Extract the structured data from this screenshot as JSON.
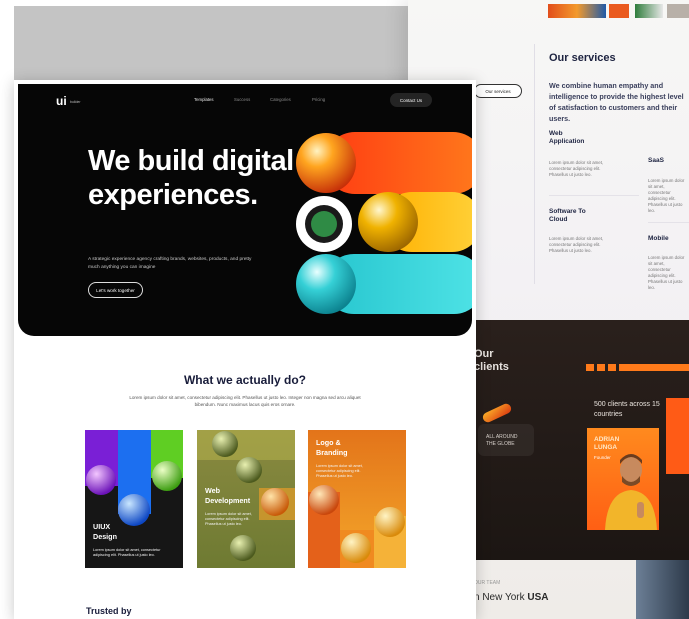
{
  "services": {
    "title": "Our services",
    "description": "We combine human empathy and intelligence to provide the highest level of satisfaction to customers and their users.",
    "pill": "Our services",
    "items": [
      {
        "title": "Web\nApplication",
        "text": "Lorem ipsum dolor sit amet, consectetur adipiscing elit. Phasellus ut justo leo."
      },
      {
        "title": "SaaS",
        "text": "Lorem ipsum dolor sit amet, consectetur adipiscing elit. Phasellus ut justo leo."
      },
      {
        "title": "Software To\nCloud",
        "text": "Lorem ipsum dolor sit amet, consectetur adipiscing elit. Phasellus ut justo leo."
      },
      {
        "title": "Mobile",
        "text": "Lorem ipsum dolor sit amet, consectetur adipiscing elit. Phasellus ut justo leo."
      }
    ]
  },
  "clients": {
    "title": "Our\nclients",
    "globe": "ALL AROUND\nTHE GLOBE",
    "count": "500 clients across 15 countries",
    "person_name": "ADRIAN\nLUNGA",
    "person_role": "Founder"
  },
  "team": {
    "label": "OUR TEAM",
    "title_prefix": "n New York ",
    "title_bold": "USA"
  },
  "header": {
    "logo": "ui",
    "logo_sub": "builder",
    "nav": [
      "Templates",
      "Success",
      "Categories",
      "Pricing"
    ],
    "contact": "Contact Us"
  },
  "hero": {
    "headline": "We build digital experiences.",
    "subtext": "A strategic experience agency crafting brands, websites, products, and pretty much anything you can imagine",
    "cta": "Let's work together"
  },
  "what": {
    "title": "What we actually do?",
    "description": "Lorem ipsum dolor sit amet, consectetur adipiscing elit. Phasellus ut justo leo. Integer non magna sed arcu aliquet bibendum. Nunc maximus lacus quis eros ornare.",
    "cards": [
      {
        "title": "UIUX\nDesign",
        "text": "Lorem ipsum dolor sit amet, consectetur adipiscing elit. Phasellus ut justo leo."
      },
      {
        "title": "Web\nDevelopment",
        "text": "Lorem ipsum dolor sit amet, consectetur adipiscing elit. Phasellus ut justo leo."
      },
      {
        "title": "Logo &\nBranding",
        "text": "Lorem ipsum dolor sit amet, consectetur adipiscing elit. Phasellus ut justo leo."
      }
    ]
  },
  "trusted": "Trusted by",
  "colors": {
    "hero_bg": "#060606",
    "accent_orange": "#ff7a1a",
    "heading_navy": "#181c3a"
  }
}
